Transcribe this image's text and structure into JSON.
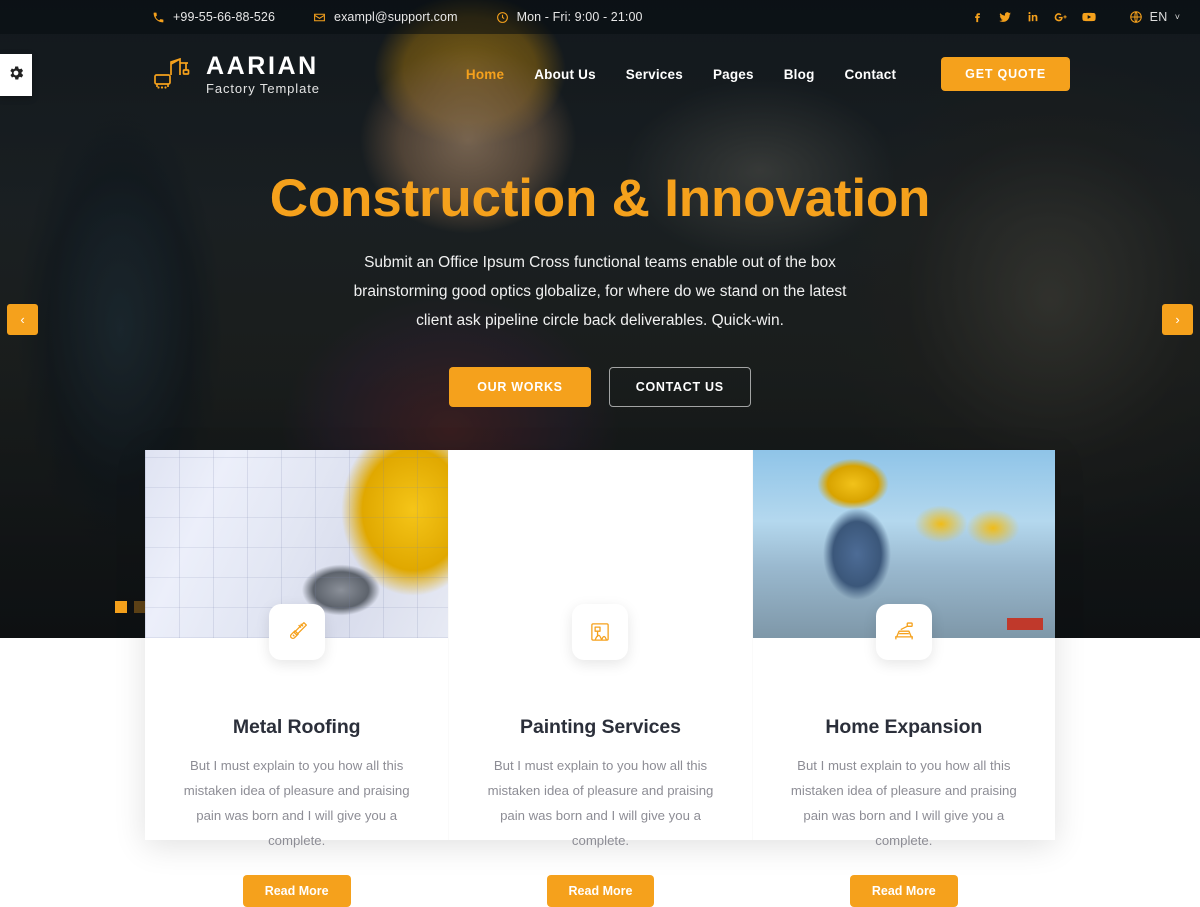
{
  "topbar": {
    "phone": "+99-55-66-88-526",
    "email": "exampl@support.com",
    "hours": "Mon - Fri: 9:00 - 21:00",
    "phone_icon": "phone-icon",
    "email_icon": "envelope-icon",
    "hours_icon": "clock-icon",
    "social": [
      {
        "name": "facebook-icon",
        "glyph": "f"
      },
      {
        "name": "twitter-icon",
        "glyph": "t"
      },
      {
        "name": "linkedin-icon",
        "glyph": "in"
      },
      {
        "name": "google-plus-icon",
        "glyph": "G+"
      },
      {
        "name": "youtube-icon",
        "glyph": "yt"
      }
    ],
    "language": "EN",
    "language_icon": "globe-icon",
    "caret": "˅"
  },
  "settings_tab": {
    "icon": "gear-icon"
  },
  "header": {
    "logo_icon": "crane-icon",
    "brand": "AARIAN",
    "tagline": "Factory Template",
    "nav": [
      {
        "label": "Home",
        "active": true
      },
      {
        "label": "About Us",
        "active": false
      },
      {
        "label": "Services",
        "active": false
      },
      {
        "label": "Pages",
        "active": false
      },
      {
        "label": "Blog",
        "active": false
      },
      {
        "label": "Contact",
        "active": false
      }
    ],
    "quote_button": "GET QUOTE"
  },
  "hero": {
    "title": "Construction & Innovation",
    "subtitle": "Submit an Office Ipsum Cross functional teams enable out of the box brainstorming good optics globalize, for where do we stand on the latest client ask pipeline circle back deliverables. Quick-win.",
    "primary_button": "OUR WORKS",
    "secondary_button": "CONTACT US",
    "prev_arrow": "‹",
    "next_arrow": "›",
    "slides": [
      {
        "active": true
      },
      {
        "active": false
      }
    ]
  },
  "services": [
    {
      "icon": "screw-bolt-icon",
      "title": "Metal Roofing",
      "text": "But I must explain to you how all this mistaken idea of pleasure and praising pain was born and I will give you a complete.",
      "button": "Read More",
      "photo": "blueprint-helmet-tools-photo"
    },
    {
      "icon": "paint-roller-icon",
      "title": "Painting Services",
      "text": "But I must explain to you how all this mistaken idea of pleasure and praising pain was born and I will give you a complete.",
      "button": "Read More",
      "photo": "site-supervisor-photo"
    },
    {
      "icon": "table-saw-icon",
      "title": "Home Expansion",
      "text": "But I must explain to you how all this mistaken idea of pleasure and praising pain was born and I will give you a complete.",
      "button": "Read More",
      "photo": "crew-with-tablet-photo"
    }
  ],
  "colors": {
    "accent": "#f5a11c",
    "heading": "#2b2f3a",
    "body_text": "#8d8d95",
    "white": "#ffffff"
  }
}
